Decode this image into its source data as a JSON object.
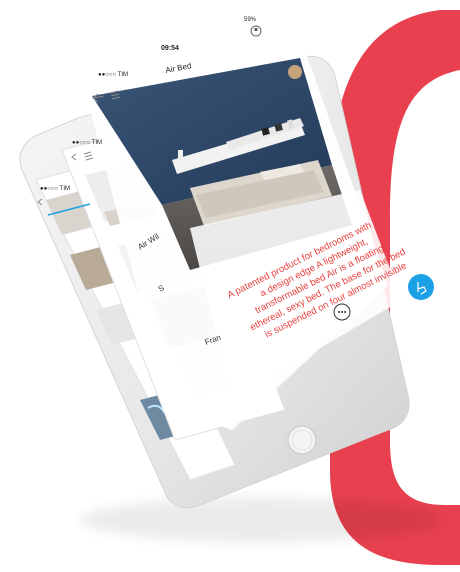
{
  "colors": {
    "brand_red": "#e8404f",
    "accent_blue": "#1da1e6",
    "text_red": "#e8403f",
    "wall": "#2e4a6b"
  },
  "status_bar": {
    "carrier_front": "●●○○○ TIM",
    "carrier_mid": "●●○○○ TIM",
    "carrier_back": "●●○○○ TIM",
    "time": "09:54",
    "battery": "59%"
  },
  "screen": {
    "title": "Air Bed",
    "list_items": [
      "Air Wil",
      "Fran",
      "S"
    ]
  },
  "card": {
    "description_lines": [
      "A patented product for bedrooms with",
      "a design edge A lightweight,",
      "transformable bed Air is a floating,",
      "ethereal, sexy bed. The base for the bed",
      "is suspended on four almost invisible"
    ],
    "more_icon": "ellipsis-icon",
    "fab_icon": "hand-pointer-icon"
  },
  "icons": {
    "back": "back-arrow-icon",
    "menu": "hamburger-menu-icon",
    "profile": "user-circle-icon"
  }
}
